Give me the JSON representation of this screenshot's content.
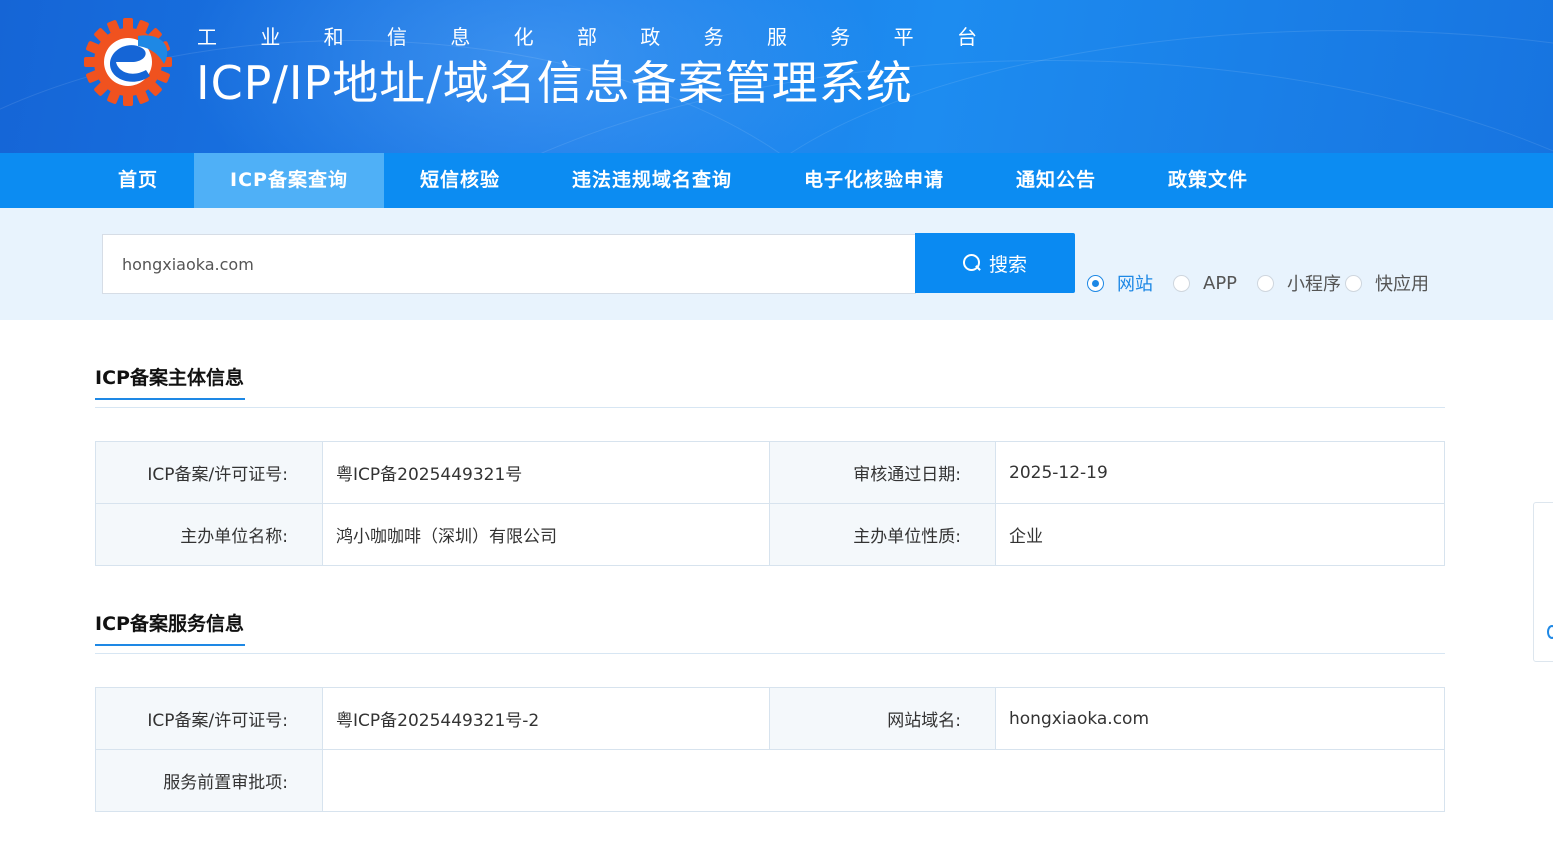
{
  "header": {
    "sub_title_chars": [
      "工",
      "业",
      "和",
      "信",
      "息",
      "化",
      "部",
      "政",
      "务",
      "服",
      "务",
      "平",
      "台"
    ],
    "main_title": "ICP/IP地址/域名信息备案管理系统",
    "logo_icon": "gear-e-logo-icon",
    "colors": {
      "banner": "#1a7ae8",
      "logo_orange": "#f0521f",
      "logo_blue": "#1565d6"
    }
  },
  "nav": {
    "items": [
      {
        "label": "首页"
      },
      {
        "label": "ICP备案查询",
        "active": true
      },
      {
        "label": "短信核验"
      },
      {
        "label": "违法违规域名查询"
      },
      {
        "label": "电子化核验申请"
      },
      {
        "label": "通知公告"
      },
      {
        "label": "政策文件"
      }
    ],
    "colors": {
      "bar": "#0c8cf2",
      "active": "#4fb0f7"
    }
  },
  "search": {
    "value": "hongxiaoka.com",
    "button_label": "搜索",
    "button_icon": "search-icon",
    "types": [
      {
        "label": "网站",
        "checked": true
      },
      {
        "label": "APP",
        "checked": false
      },
      {
        "label": "小程序",
        "checked": false
      },
      {
        "label": "快应用",
        "checked": false
      }
    ]
  },
  "subject": {
    "title": "ICP备案主体信息",
    "rows": [
      {
        "k1": "ICP备案/许可证号:",
        "v1": "粤ICP备2025449321号",
        "k2": "审核通过日期:",
        "v2": "2025-12-19"
      },
      {
        "k1": "主办单位名称:",
        "v1": "鸿小咖咖啡（深圳）有限公司",
        "k2": "主办单位性质:",
        "v2": "企业"
      }
    ]
  },
  "service": {
    "title": "ICP备案服务信息",
    "rows": [
      {
        "k1": "ICP备案/许可证号:",
        "v1": "粤ICP备2025449321号-2",
        "k2": "网站域名:",
        "v2": "hongxiaoka.com"
      }
    ],
    "approval_label": "服务前置审批项:",
    "approval_value": ""
  }
}
